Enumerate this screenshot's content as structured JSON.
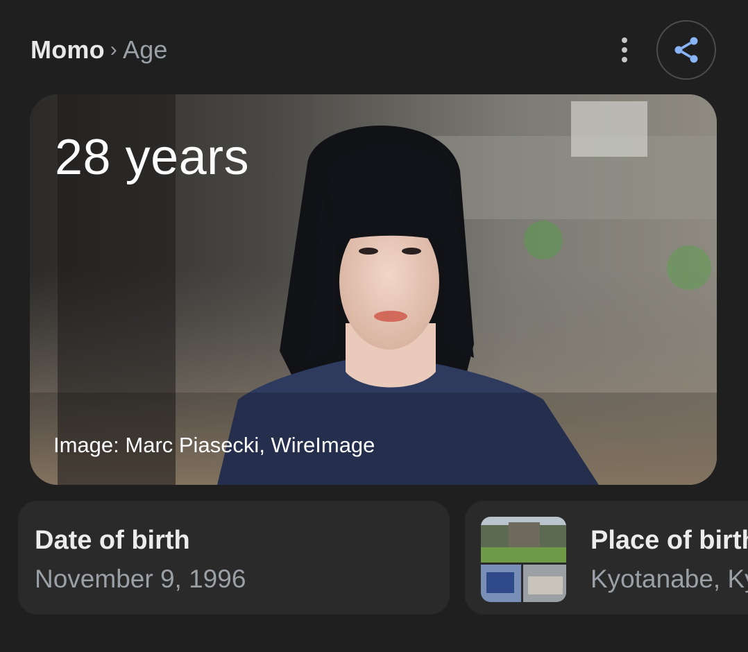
{
  "breadcrumb": {
    "root": "Momo",
    "separator": "›",
    "current": "Age"
  },
  "actions": {
    "more_icon": "more-vert-icon",
    "share_icon": "share-icon"
  },
  "hero": {
    "age_text": "28 years",
    "image_credit": "Image: Marc Piasecki, WireImage"
  },
  "cards": {
    "date_of_birth": {
      "label": "Date of birth",
      "value": "November 9, 1996"
    },
    "place_of_birth": {
      "label": "Place of birth",
      "value": "Kyotanabe, Kyoto"
    }
  },
  "colors": {
    "background": "#1f1f1f",
    "card": "#2a2a2a",
    "accent_share": "#8ab4f8",
    "secondary_text": "#9aa0a6"
  }
}
